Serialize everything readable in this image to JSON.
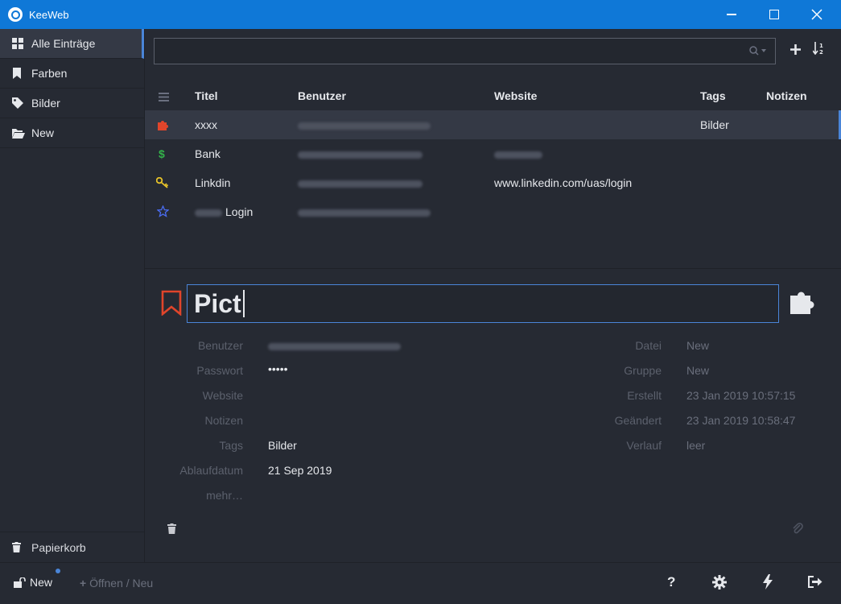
{
  "window": {
    "title": "KeeWeb"
  },
  "sidebar": {
    "items": [
      {
        "label": "Alle Einträge",
        "icon": "grid-icon"
      },
      {
        "label": "Farben",
        "icon": "bookmark-icon"
      },
      {
        "label": "Bilder",
        "icon": "tag-icon"
      },
      {
        "label": "New",
        "icon": "folder-open-icon"
      }
    ],
    "trash": {
      "label": "Papierkorb",
      "icon": "trash-icon"
    }
  },
  "search": {
    "value": "",
    "placeholder": ""
  },
  "list": {
    "columns": [
      "Titel",
      "Benutzer",
      "Website",
      "Tags",
      "Notizen"
    ],
    "rows": [
      {
        "icon": "puzzle-icon",
        "icon_color": "#e0452b",
        "title": "xxxx",
        "user": "blurred",
        "website": "",
        "tags": "Bilder"
      },
      {
        "icon": "dollar-icon",
        "icon_color": "#33b24a",
        "title": "Bank",
        "user": "blurred",
        "website": "blurred",
        "tags": ""
      },
      {
        "icon": "key-icon",
        "icon_color": "#e6c229",
        "title": "Linkdin",
        "user": "blurred",
        "website": "www.linkedin.com/uas/login",
        "tags": ""
      },
      {
        "icon": "star-icon",
        "icon_color": "#4a6cf0",
        "title": "Login",
        "user": "blurred",
        "website": "",
        "tags": ""
      }
    ]
  },
  "detail": {
    "title_value": "Pict",
    "labels": {
      "user": "Benutzer",
      "password": "Passwort",
      "website": "Website",
      "notes": "Notizen",
      "tags": "Tags",
      "expires": "Ablaufdatum",
      "more": "mehr…",
      "file": "Datei",
      "group": "Gruppe",
      "created": "Erstellt",
      "modified": "Geändert",
      "history": "Verlauf"
    },
    "values": {
      "password": "•••••",
      "tags": "Bilder",
      "expires": "21 Sep 2019",
      "file": "New",
      "group": "New",
      "created": "23 Jan 2019 10:57:15",
      "modified": "23 Jan 2019 10:58:47",
      "history": "leer"
    }
  },
  "footer": {
    "file_label": "New",
    "open_label": "Öffnen / Neu",
    "buttons": [
      "help-icon",
      "settings-icon",
      "generator-icon",
      "lock-icon"
    ],
    "help_label": "?"
  },
  "colors": {
    "accent": "#4a85d8",
    "titlebar": "#0f78d7",
    "background": "#262a33"
  }
}
